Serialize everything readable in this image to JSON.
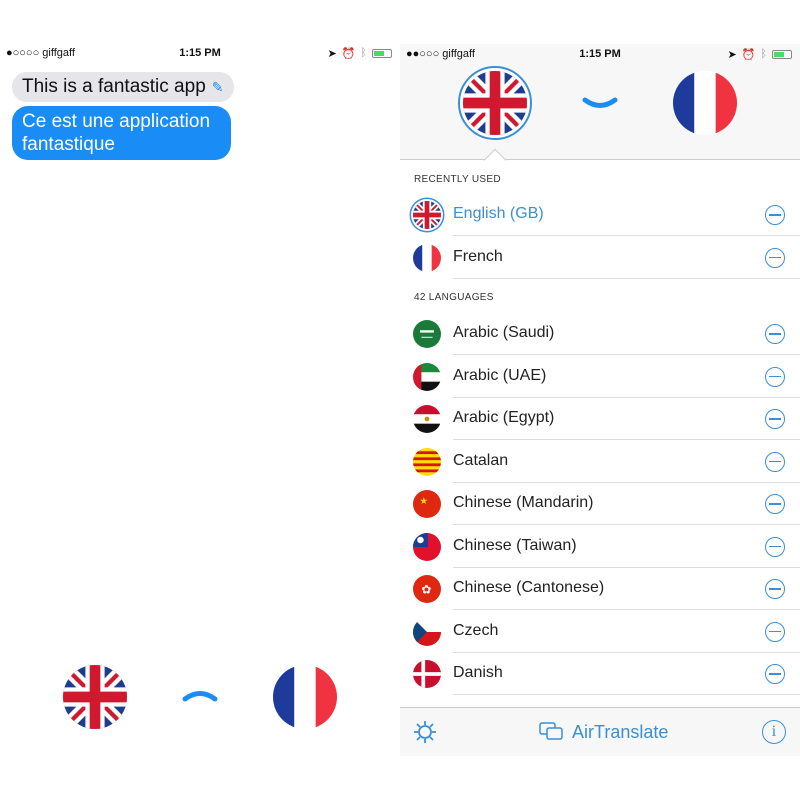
{
  "left": {
    "status": {
      "carrier": "●○○○○ giffgaff",
      "time": "1:15 PM"
    },
    "source_text": "This is a fantastic app",
    "translated_text": "Ce est une application fantastique",
    "source_flag": "gb",
    "target_flag": "fr",
    "swap_icon": "chevron-up-icon"
  },
  "right": {
    "status": {
      "carrier": "●●○○○ giffgaff",
      "time": "1:15 PM"
    },
    "source_flag": "gb",
    "target_flag": "fr",
    "swap_icon": "chevron-down-icon",
    "recent_header": "RECENTLY USED",
    "recent": [
      {
        "name": "English (GB)",
        "flag": "gb",
        "selected": true
      },
      {
        "name": "French",
        "flag": "fr"
      }
    ],
    "languages_header": "42 LANGUAGES",
    "languages": [
      {
        "name": "Arabic (Saudi)",
        "flag": "sa"
      },
      {
        "name": "Arabic (UAE)",
        "flag": "ae"
      },
      {
        "name": "Arabic (Egypt)",
        "flag": "eg"
      },
      {
        "name": "Catalan",
        "flag": "cat"
      },
      {
        "name": "Chinese (Mandarin)",
        "flag": "cn"
      },
      {
        "name": "Chinese (Taiwan)",
        "flag": "tw"
      },
      {
        "name": "Chinese (Cantonese)",
        "flag": "hk"
      },
      {
        "name": "Czech",
        "flag": "cz"
      },
      {
        "name": "Danish",
        "flag": "dk"
      }
    ],
    "toolbar": {
      "settings_icon": "gear-icon",
      "title": "AirTranslate",
      "app_icon": "speech-bubbles-icon",
      "info_icon": "info-icon"
    }
  },
  "colors": {
    "accent": "#3a8fd6",
    "bubble_blue": "#1a8cf5"
  }
}
